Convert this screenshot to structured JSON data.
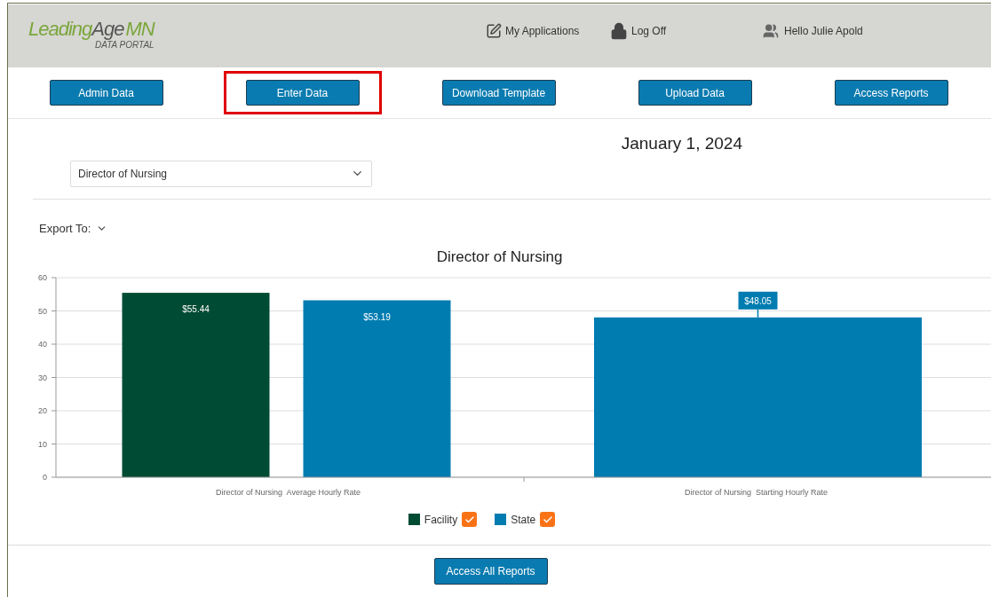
{
  "logo": {
    "parts": [
      "Leading",
      "Age",
      "MN"
    ],
    "subtitle": "DATA PORTAL"
  },
  "header_links": [
    {
      "kind": "applications",
      "label": "My Applications"
    },
    {
      "kind": "logoff",
      "label": "Log Off"
    },
    {
      "kind": "user",
      "label": "Hello Julie Apold"
    }
  ],
  "nav_buttons": [
    {
      "label": "Admin Data",
      "highlighted": false
    },
    {
      "label": "Enter Data",
      "highlighted": true
    },
    {
      "label": "Download Template",
      "highlighted": false
    },
    {
      "label": "Upload Data",
      "highlighted": false
    },
    {
      "label": "Access Reports",
      "highlighted": false
    }
  ],
  "date": "January 1, 2024",
  "position_select": {
    "value": "Director of Nursing"
  },
  "export": {
    "label": "Export To:"
  },
  "chart": {
    "chart_data": {
      "type": "bar",
      "title": "Director of Nursing",
      "categories": [
        "Director of Nursing  Average Hourly Rate",
        "Director of Nursing  Starting Hourly Rate"
      ],
      "series": [
        {
          "name": "Facility",
          "color": "#004b33",
          "values": [
            55.44,
            null
          ],
          "value_labels": [
            "$55.44",
            null
          ]
        },
        {
          "name": "State",
          "color": "#007cb0",
          "values": [
            53.19,
            48.05
          ],
          "value_labels": [
            "$53.19",
            "$48.05"
          ]
        }
      ],
      "ylim": [
        0,
        60
      ],
      "yticks": [
        0,
        10,
        20,
        30,
        40,
        50,
        60
      ],
      "data_labels": true,
      "grid": true,
      "legend": true
    },
    "legend": [
      {
        "checked": true
      },
      {
        "checked": true
      }
    ]
  },
  "footer_button": {
    "label": "Access All Reports"
  }
}
